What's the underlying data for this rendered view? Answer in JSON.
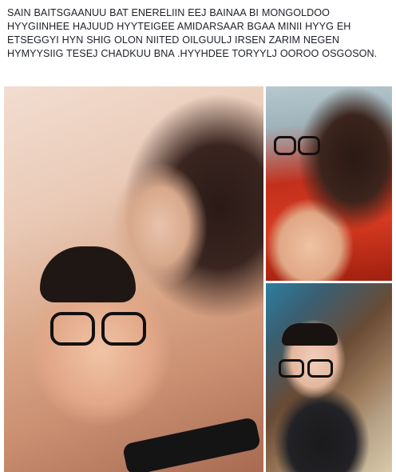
{
  "post": {
    "text": "SAIN BAITSGAANUU BAT ENERELIIN EEJ BAINAA BI MONGOLDOO HYYGIINHEE HAJUUD HYYTEIGEE AMIDARSAAR BGAA MINII HYYG EH ETSEGGYI HYN SHIG OLON NIITED OILGUULJ IRSEN ZARIM NEGEN HYMYYSIIG TESEJ CHADKUU BNA .HYYHDEE TORYYLJ OOROO OSGOSON."
  },
  "photos": [
    {
      "subject": "mother-and-child-selfie"
    },
    {
      "subject": "mother-kissing-child"
    },
    {
      "subject": "child-with-glasses-by-aquarium"
    }
  ]
}
